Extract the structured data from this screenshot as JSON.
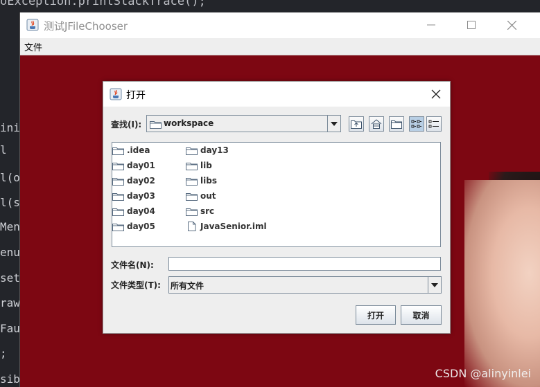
{
  "background_code": {
    "top_line": "oException.printStackTrace();",
    "left_fragments": [
      "init",
      "l",
      "l(op",
      "l(sa",
      "Men",
      "enuB",
      " set",
      "rawA",
      "Faul",
      ";",
      "sibl"
    ]
  },
  "outer_window": {
    "title": "测试JFileChooser",
    "menu": [
      "文件"
    ],
    "bg_color": "#7d0712"
  },
  "watermark": "CSDN @alinyinlei",
  "dialog": {
    "title": "打开",
    "look_in_label": "查找(I):",
    "look_in_value": "workspace",
    "toolbar_icons": [
      "up-one-level-icon",
      "home-icon",
      "new-folder-icon",
      "list-view-icon",
      "details-view-icon"
    ],
    "files": [
      {
        "name": ".idea",
        "type": "folder"
      },
      {
        "name": "day01",
        "type": "folder"
      },
      {
        "name": "day02",
        "type": "folder"
      },
      {
        "name": "day03",
        "type": "folder"
      },
      {
        "name": "day04",
        "type": "folder"
      },
      {
        "name": "day05",
        "type": "folder"
      },
      {
        "name": "day13",
        "type": "folder"
      },
      {
        "name": "lib",
        "type": "folder"
      },
      {
        "name": "libs",
        "type": "folder"
      },
      {
        "name": "out",
        "type": "folder"
      },
      {
        "name": "src",
        "type": "folder"
      },
      {
        "name": "JavaSenior.iml",
        "type": "file"
      }
    ],
    "file_name_label": "文件名(N):",
    "file_name_value": "",
    "file_type_label": "文件类型(T):",
    "file_type_value": "所有文件",
    "open_button": "打开",
    "cancel_button": "取消"
  }
}
